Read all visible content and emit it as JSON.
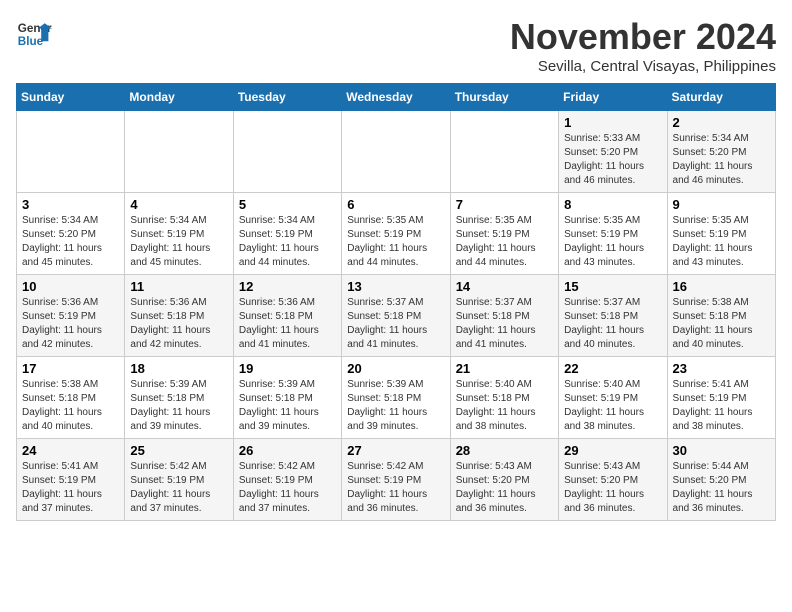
{
  "logo": {
    "line1": "General",
    "line2": "Blue"
  },
  "title": "November 2024",
  "location": "Sevilla, Central Visayas, Philippines",
  "days_of_week": [
    "Sunday",
    "Monday",
    "Tuesday",
    "Wednesday",
    "Thursday",
    "Friday",
    "Saturday"
  ],
  "weeks": [
    [
      {
        "day": "",
        "info": ""
      },
      {
        "day": "",
        "info": ""
      },
      {
        "day": "",
        "info": ""
      },
      {
        "day": "",
        "info": ""
      },
      {
        "day": "",
        "info": ""
      },
      {
        "day": "1",
        "info": "Sunrise: 5:33 AM\nSunset: 5:20 PM\nDaylight: 11 hours\nand 46 minutes."
      },
      {
        "day": "2",
        "info": "Sunrise: 5:34 AM\nSunset: 5:20 PM\nDaylight: 11 hours\nand 46 minutes."
      }
    ],
    [
      {
        "day": "3",
        "info": "Sunrise: 5:34 AM\nSunset: 5:20 PM\nDaylight: 11 hours\nand 45 minutes."
      },
      {
        "day": "4",
        "info": "Sunrise: 5:34 AM\nSunset: 5:19 PM\nDaylight: 11 hours\nand 45 minutes."
      },
      {
        "day": "5",
        "info": "Sunrise: 5:34 AM\nSunset: 5:19 PM\nDaylight: 11 hours\nand 44 minutes."
      },
      {
        "day": "6",
        "info": "Sunrise: 5:35 AM\nSunset: 5:19 PM\nDaylight: 11 hours\nand 44 minutes."
      },
      {
        "day": "7",
        "info": "Sunrise: 5:35 AM\nSunset: 5:19 PM\nDaylight: 11 hours\nand 44 minutes."
      },
      {
        "day": "8",
        "info": "Sunrise: 5:35 AM\nSunset: 5:19 PM\nDaylight: 11 hours\nand 43 minutes."
      },
      {
        "day": "9",
        "info": "Sunrise: 5:35 AM\nSunset: 5:19 PM\nDaylight: 11 hours\nand 43 minutes."
      }
    ],
    [
      {
        "day": "10",
        "info": "Sunrise: 5:36 AM\nSunset: 5:19 PM\nDaylight: 11 hours\nand 42 minutes."
      },
      {
        "day": "11",
        "info": "Sunrise: 5:36 AM\nSunset: 5:18 PM\nDaylight: 11 hours\nand 42 minutes."
      },
      {
        "day": "12",
        "info": "Sunrise: 5:36 AM\nSunset: 5:18 PM\nDaylight: 11 hours\nand 41 minutes."
      },
      {
        "day": "13",
        "info": "Sunrise: 5:37 AM\nSunset: 5:18 PM\nDaylight: 11 hours\nand 41 minutes."
      },
      {
        "day": "14",
        "info": "Sunrise: 5:37 AM\nSunset: 5:18 PM\nDaylight: 11 hours\nand 41 minutes."
      },
      {
        "day": "15",
        "info": "Sunrise: 5:37 AM\nSunset: 5:18 PM\nDaylight: 11 hours\nand 40 minutes."
      },
      {
        "day": "16",
        "info": "Sunrise: 5:38 AM\nSunset: 5:18 PM\nDaylight: 11 hours\nand 40 minutes."
      }
    ],
    [
      {
        "day": "17",
        "info": "Sunrise: 5:38 AM\nSunset: 5:18 PM\nDaylight: 11 hours\nand 40 minutes."
      },
      {
        "day": "18",
        "info": "Sunrise: 5:39 AM\nSunset: 5:18 PM\nDaylight: 11 hours\nand 39 minutes."
      },
      {
        "day": "19",
        "info": "Sunrise: 5:39 AM\nSunset: 5:18 PM\nDaylight: 11 hours\nand 39 minutes."
      },
      {
        "day": "20",
        "info": "Sunrise: 5:39 AM\nSunset: 5:18 PM\nDaylight: 11 hours\nand 39 minutes."
      },
      {
        "day": "21",
        "info": "Sunrise: 5:40 AM\nSunset: 5:18 PM\nDaylight: 11 hours\nand 38 minutes."
      },
      {
        "day": "22",
        "info": "Sunrise: 5:40 AM\nSunset: 5:19 PM\nDaylight: 11 hours\nand 38 minutes."
      },
      {
        "day": "23",
        "info": "Sunrise: 5:41 AM\nSunset: 5:19 PM\nDaylight: 11 hours\nand 38 minutes."
      }
    ],
    [
      {
        "day": "24",
        "info": "Sunrise: 5:41 AM\nSunset: 5:19 PM\nDaylight: 11 hours\nand 37 minutes."
      },
      {
        "day": "25",
        "info": "Sunrise: 5:42 AM\nSunset: 5:19 PM\nDaylight: 11 hours\nand 37 minutes."
      },
      {
        "day": "26",
        "info": "Sunrise: 5:42 AM\nSunset: 5:19 PM\nDaylight: 11 hours\nand 37 minutes."
      },
      {
        "day": "27",
        "info": "Sunrise: 5:42 AM\nSunset: 5:19 PM\nDaylight: 11 hours\nand 36 minutes."
      },
      {
        "day": "28",
        "info": "Sunrise: 5:43 AM\nSunset: 5:20 PM\nDaylight: 11 hours\nand 36 minutes."
      },
      {
        "day": "29",
        "info": "Sunrise: 5:43 AM\nSunset: 5:20 PM\nDaylight: 11 hours\nand 36 minutes."
      },
      {
        "day": "30",
        "info": "Sunrise: 5:44 AM\nSunset: 5:20 PM\nDaylight: 11 hours\nand 36 minutes."
      }
    ]
  ]
}
